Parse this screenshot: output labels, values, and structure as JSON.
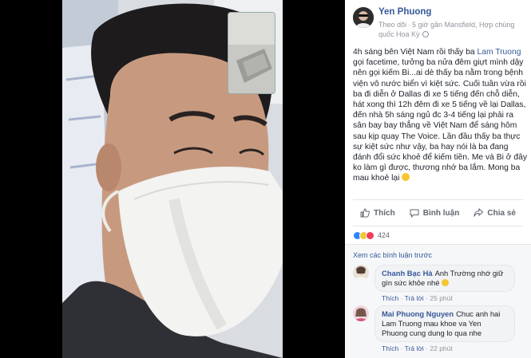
{
  "post": {
    "author": "Yen Phuong",
    "follow": "Theo dõi",
    "time": "5 giờ gần Mansfield, Hợp chúng quốc Hoa Kỳ",
    "privacy_icon": "globe-icon",
    "body_part1": "4h sáng bên Việt Nam rồi thấy ba ",
    "mention": "Lam Truong",
    "body_part2": " gọi facetime, tưởng ba nửa đêm giựt mình dậy nên gọi kiếm Bi...ai dè thấy ba nằm trong bệnh viện vô nước biển vì kiệt sức. Cuối tuần vừa rồi ba đi diễn ở Dallas đi xe 5 tiếng đến chỗ diễn, hát xong thì 12h đêm đi xe 5 tiếng về lại Dallas, đến nhà 5h sáng ngủ đc 3-4 tiếng lại phải ra sân bay bay thẳng về Việt Nam để sáng hôm sau kịp quay The Voice. Lần đầu thấy ba thực sự kiệt sức như vậy, ba hay nói là ba đang đánh đổi sức khoẻ để kiếm tiền. Me và Bi ở đây ko làm gì được, thương nhớ ba lắm. Mong ba mau khoẻ lại ",
    "body_emoji": "sad-face-emoji"
  },
  "actions": {
    "like": "Thích",
    "comment": "Bình luận",
    "share": "Chia sẻ"
  },
  "reactions": {
    "count": "424",
    "types": [
      "like",
      "haha",
      "love"
    ]
  },
  "comments": {
    "view_previous": "Xem các bình luận trước",
    "items": [
      {
        "name": "Chanh Bạc Hà",
        "text": "Anh Trường nhớ giữ gìn sức khỏe nhé ",
        "like": "Thích",
        "reply": "Trả lời",
        "time": "25 phút"
      },
      {
        "name": "Mai Phuong Nguyen",
        "text": "Chuc anh hai Lam Truong mau khoe va Yen Phuong cung dung lo qua nhe",
        "like": "Thích",
        "reply": "Trả lời",
        "time": "22 phút"
      }
    ]
  },
  "colors": {
    "link": "#365899",
    "text": "#1d2129",
    "meta": "#90949c",
    "like_blue": "#2d86ff",
    "love_red": "#f33e58",
    "haha_yellow": "#f7c52e"
  }
}
